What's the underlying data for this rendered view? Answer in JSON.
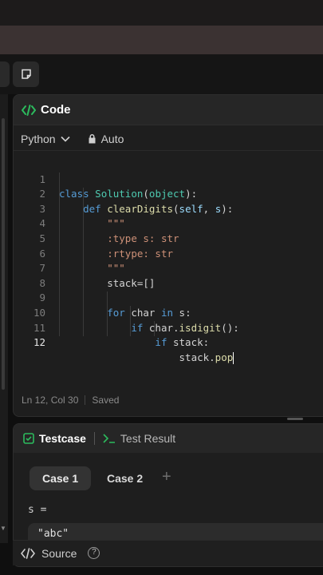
{
  "colors": {
    "accent_green": "#2cbb5d",
    "code_keyword": "#569cd6",
    "code_function": "#dcdcaa",
    "code_class": "#4ec9b0",
    "code_string": "#ce9178"
  },
  "toolbar": {
    "note_icon": "note-icon"
  },
  "code_panel": {
    "title": "Code",
    "icon": "code-icon",
    "language": "Python",
    "mode": "Auto",
    "lines": [
      {
        "num": "1",
        "text": "class Solution(object):"
      },
      {
        "num": "2",
        "text": "    def clearDigits(self, s):"
      },
      {
        "num": "3",
        "text": "        \"\"\""
      },
      {
        "num": "4",
        "text": "        :type s: str"
      },
      {
        "num": "5",
        "text": "        :rtype: str"
      },
      {
        "num": "6",
        "text": "        \"\"\""
      },
      {
        "num": "7",
        "text": "        stack=[]"
      },
      {
        "num": "8",
        "text": ""
      },
      {
        "num": "9",
        "text": "        for char in s:"
      },
      {
        "num": "10",
        "text": "            if char.isdigit():"
      },
      {
        "num": "11",
        "text": "                if stack:"
      },
      {
        "num": "12",
        "text": "                    stack.pop"
      }
    ],
    "status_position": "Ln 12, Col 30",
    "status_saved": "Saved"
  },
  "test_panel": {
    "tab_testcase": "Testcase",
    "tab_result": "Test Result",
    "cases": [
      "Case 1",
      "Case 2"
    ],
    "add_label": "+",
    "var_name": "s =",
    "var_value": "\"abc\""
  },
  "bottom_bar": {
    "source_label": "Source",
    "help_label": "?"
  }
}
